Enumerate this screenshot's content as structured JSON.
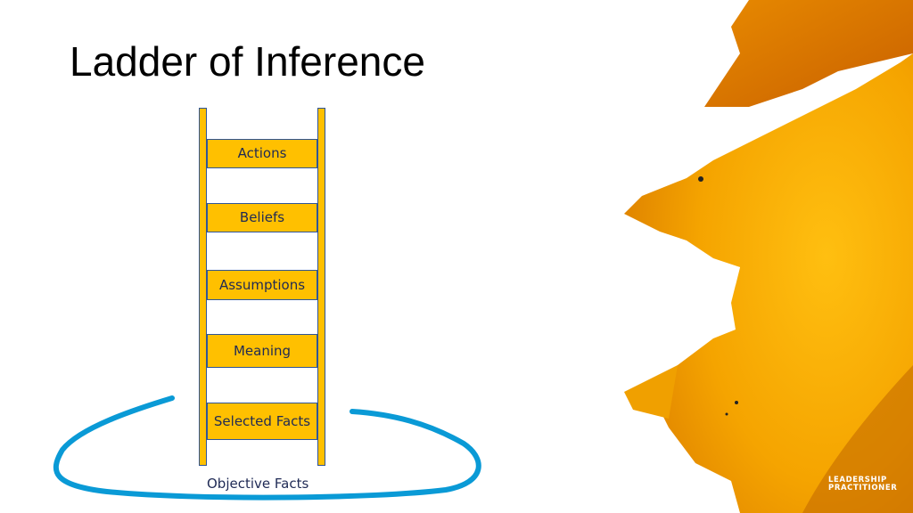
{
  "slide": {
    "title": "Ladder of Inference",
    "ladder": {
      "rungs": [
        {
          "label": "Actions"
        },
        {
          "label": "Beliefs"
        },
        {
          "label": "Assumptions"
        },
        {
          "label": "Meaning"
        },
        {
          "label": "Selected Facts"
        }
      ],
      "base_label": "Objective Facts"
    },
    "logo": {
      "line1": "LEADERSHIP",
      "line2": "PRACTITIONER"
    },
    "colors": {
      "rung_fill": "#ffc000",
      "rung_border": "#2f5597",
      "loop_stroke": "#0a9ad6",
      "text": "#1f2a55"
    }
  }
}
